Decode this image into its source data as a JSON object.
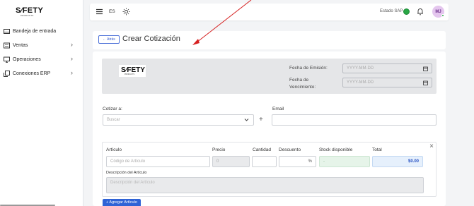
{
  "brand": {
    "logo_text": "S∕FETY",
    "logo_sub": "PRODUCTS"
  },
  "sidebar": {
    "items": [
      {
        "label": "Bandeja de entrada",
        "icon": "inbox-icon",
        "has_chevron": false
      },
      {
        "label": "Ventas",
        "icon": "sales-icon",
        "has_chevron": true
      },
      {
        "label": "Operaciones",
        "icon": "monitor-icon",
        "has_chevron": true
      },
      {
        "label": "Conexiones ERP",
        "icon": "connection-icon",
        "has_chevron": true
      }
    ],
    "chevron": "›"
  },
  "topbar": {
    "language": "ES",
    "sap_status_label": "Estado SAP",
    "sap_status_color": "#28a745",
    "avatar_initials": "MJ"
  },
  "header": {
    "back_label": "← Atrás",
    "title": "Crear Cotización"
  },
  "document": {
    "logo_text": "S∕FETY",
    "logo_sub": "PRODUCTS",
    "emission_label": "Fecha de Emisión:",
    "emission_placeholder": "YYYY-MM-DD",
    "expiry_label_1": "Fecha de",
    "expiry_label_2": "Vencimiento:",
    "expiry_placeholder": "YYYY-MM-DD"
  },
  "quote": {
    "to_label": "Cotizar a:",
    "search_placeholder": "Buscar",
    "add_symbol": "+",
    "email_label": "Email",
    "email_value": ""
  },
  "items": {
    "headers": {
      "article": "Artículo",
      "price": "Precio",
      "quantity": "Cantidad",
      "discount": "Descuento",
      "stock": "Stock disponible",
      "total": "Total"
    },
    "article_placeholder": "Código de Artículo",
    "price_value": "0",
    "quantity_value": "",
    "discount_suffix": "%",
    "stock_value": "-",
    "total_value": "$0.00",
    "description_label": "Descripción del Artículo",
    "description_placeholder": "Descripción del Artículo",
    "close_symbol": "×",
    "add_item_label": "+ Agregar Artículo"
  },
  "colors": {
    "accent": "#2f63d6",
    "annotation_arrow": "#d62020"
  }
}
